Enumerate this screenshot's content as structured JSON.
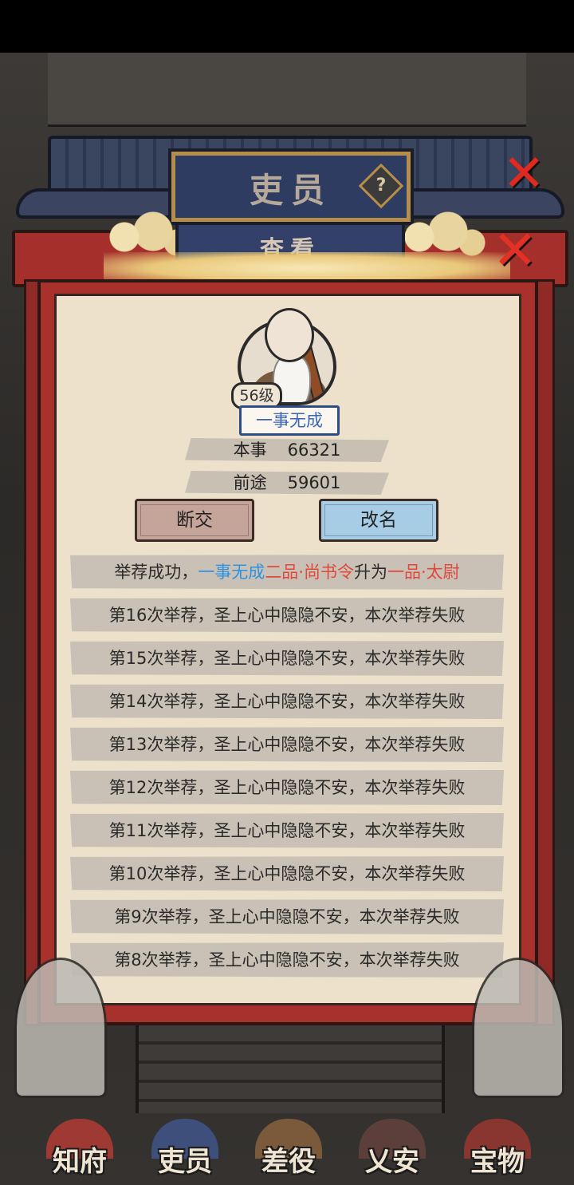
{
  "header": {
    "title": "吏员",
    "help_icon": "?",
    "close_icon": "✕"
  },
  "dialog": {
    "title": "查看",
    "close_icon": "✕",
    "official": {
      "level": "56级",
      "name": "一事无成",
      "stats": [
        {
          "label": "本事",
          "value": "66321"
        },
        {
          "label": "前途",
          "value": "59601"
        }
      ]
    },
    "buttons": {
      "sever": "断交",
      "rename": "改名"
    },
    "log": {
      "first": {
        "prefix": "举荐成功，",
        "name": "一事无成",
        "from_rank": "二品·尚书令",
        "verb": "升为",
        "to_rank": "一品·太尉"
      },
      "failures": [
        "第16次举荐，圣上心中隐隐不安，本次举荐失败",
        "第15次举荐，圣上心中隐隐不安，本次举荐失败",
        "第14次举荐，圣上心中隐隐不安，本次举荐失败",
        "第13次举荐，圣上心中隐隐不安，本次举荐失败",
        "第12次举荐，圣上心中隐隐不安，本次举荐失败",
        "第11次举荐，圣上心中隐隐不安，本次举荐失败",
        "第10次举荐，圣上心中隐隐不安，本次举荐失败",
        "第9次举荐，圣上心中隐隐不安，本次举荐失败",
        "第8次举荐，圣上心中隐隐不安，本次举荐失败"
      ]
    }
  },
  "bottom_nav": [
    "知府",
    "吏员",
    "差役",
    "乂安",
    "宝物"
  ]
}
